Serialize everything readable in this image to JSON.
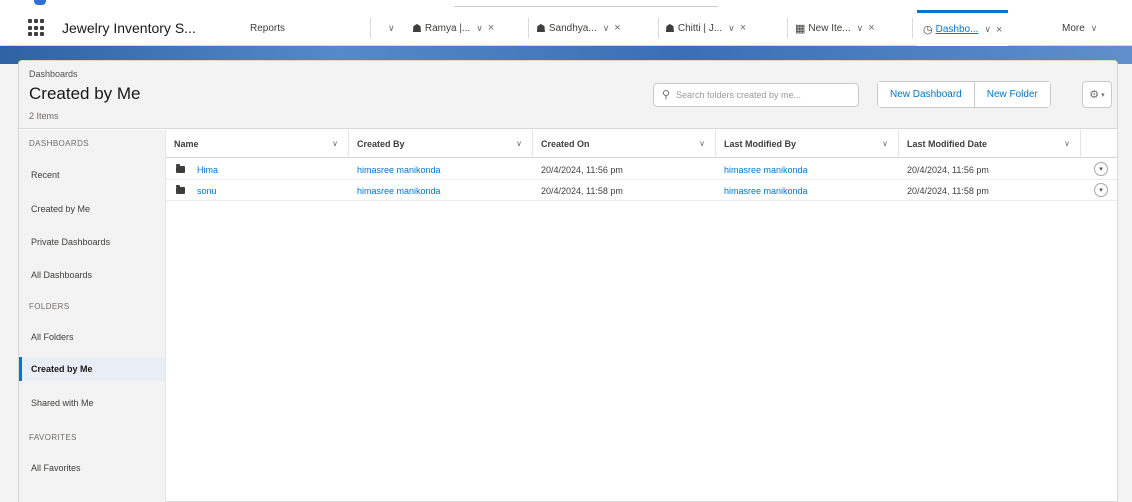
{
  "nav": {
    "app_name": "Jewelry Inventory S...",
    "reports_tab": "Reports",
    "tabs": [
      {
        "label": "Ramya |...",
        "icon": "shopping-bag-icon"
      },
      {
        "label": "Sandhya...",
        "icon": "shopping-bag-icon"
      },
      {
        "label": "Chitti | J...",
        "icon": "shopping-bag-icon"
      },
      {
        "label": "New Ite...",
        "icon": "calendar-icon"
      },
      {
        "label": "Dashbo...",
        "icon": "dashboard-icon",
        "active": true
      }
    ],
    "more_label": "More"
  },
  "header": {
    "breadcrumb": "Dashboards",
    "title": "Created by Me",
    "count": "2 Items",
    "search_placeholder": "Search folders created by me...",
    "new_dashboard_label": "New Dashboard",
    "new_folder_label": "New Folder"
  },
  "sidebar": {
    "dashboards_heading": "DASHBOARDS",
    "dashboards_items": [
      "Recent",
      "Created by Me",
      "Private Dashboards",
      "All Dashboards"
    ],
    "folders_heading": "FOLDERS",
    "folders_items": [
      "All Folders",
      "Created by Me",
      "Shared with Me"
    ],
    "favorites_heading": "FAVORITES",
    "favorites_items": [
      "All Favorites"
    ],
    "active_item": "Created by Me"
  },
  "table": {
    "columns": [
      "Name",
      "Created By",
      "Created On",
      "Last Modified By",
      "Last Modified Date"
    ],
    "rows": [
      {
        "name": "Hima",
        "created_by": "himasree manikonda",
        "created_on": "20/4/2024, 11:56 pm",
        "last_modified_by": "himasree manikonda",
        "last_modified_date": "20/4/2024, 11:56 pm"
      },
      {
        "name": "sonu",
        "created_by": "himasree manikonda",
        "created_on": "20/4/2024, 11:58 pm",
        "last_modified_by": "himasree manikonda",
        "last_modified_date": "20/4/2024, 11:58 pm"
      }
    ]
  },
  "colors": {
    "accent": "#0176d3",
    "banner": "#3a6fb4",
    "background": "#f3f3f3"
  }
}
